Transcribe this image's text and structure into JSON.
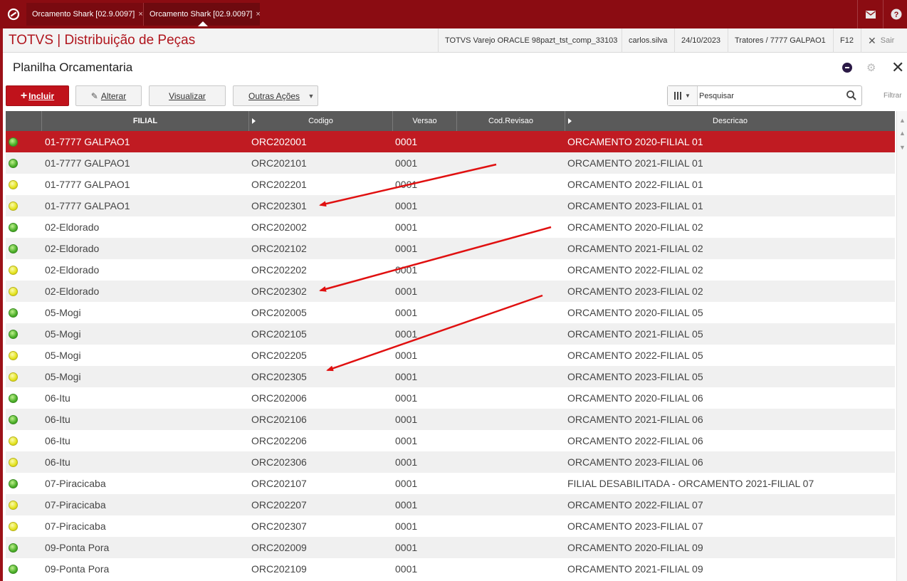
{
  "tabs": [
    {
      "label": "Orcamento Shark [02.9.0097]",
      "close": "×"
    },
    {
      "label": "Orcamento Shark [02.9.0097]",
      "close": "×"
    }
  ],
  "header": {
    "app_title": "TOTVS | Distribuição de Peças",
    "environment": "TOTVS Varejo ORACLE 98pazt_tst_comp_33103",
    "user": "carlos.silva",
    "date": "24/10/2023",
    "branch": "Tratores / 7777 GALPAO1",
    "shortcut": "F12",
    "exit_label": "Sair"
  },
  "page": {
    "title": "Planilha Orcamentaria"
  },
  "toolbar": {
    "include_label": "Incluir",
    "alter_label": "Alterar",
    "view_label": "Visualizar",
    "more_actions_label": "Outras Ações"
  },
  "search": {
    "placeholder": "Pesquisar",
    "filter_label": "Filtrar"
  },
  "colors": {
    "brand_red": "#8b0c12",
    "selected_row": "#c01b22",
    "status_green": "#4db02a",
    "status_yellow": "#e4e31f"
  },
  "grid": {
    "columns": [
      "FILIAL",
      "Codigo",
      "Versao",
      "Cod.Revisao",
      "Descricao"
    ],
    "rows": [
      {
        "status": "green",
        "filial": "01-7777 GALPAO1",
        "codigo": "ORC202001",
        "versao": "0001",
        "cod_revisao": "",
        "descricao": "ORCAMENTO 2020-FILIAL 01",
        "selected": true
      },
      {
        "status": "green",
        "filial": "01-7777 GALPAO1",
        "codigo": "ORC202101",
        "versao": "0001",
        "cod_revisao": "",
        "descricao": "ORCAMENTO 2021-FILIAL 01"
      },
      {
        "status": "yellow",
        "filial": "01-7777 GALPAO1",
        "codigo": "ORC202201",
        "versao": "0001",
        "cod_revisao": "",
        "descricao": "ORCAMENTO 2022-FILIAL 01"
      },
      {
        "status": "yellow",
        "filial": "01-7777 GALPAO1",
        "codigo": "ORC202301",
        "versao": "0001",
        "cod_revisao": "",
        "descricao": "ORCAMENTO 2023-FILIAL 01"
      },
      {
        "status": "green",
        "filial": "02-Eldorado",
        "codigo": "ORC202002",
        "versao": "0001",
        "cod_revisao": "",
        "descricao": "ORCAMENTO 2020-FILIAL 02"
      },
      {
        "status": "green",
        "filial": "02-Eldorado",
        "codigo": "ORC202102",
        "versao": "0001",
        "cod_revisao": "",
        "descricao": "ORCAMENTO 2021-FILIAL 02"
      },
      {
        "status": "yellow",
        "filial": "02-Eldorado",
        "codigo": "ORC202202",
        "versao": "0001",
        "cod_revisao": "",
        "descricao": "ORCAMENTO 2022-FILIAL 02"
      },
      {
        "status": "yellow",
        "filial": "02-Eldorado",
        "codigo": "ORC202302",
        "versao": "0001",
        "cod_revisao": "",
        "descricao": "ORCAMENTO 2023-FILIAL 02"
      },
      {
        "status": "green",
        "filial": "05-Mogi",
        "codigo": "ORC202005",
        "versao": "0001",
        "cod_revisao": "",
        "descricao": "ORCAMENTO 2020-FILIAL 05"
      },
      {
        "status": "green",
        "filial": "05-Mogi",
        "codigo": "ORC202105",
        "versao": "0001",
        "cod_revisao": "",
        "descricao": "ORCAMENTO 2021-FILIAL 05"
      },
      {
        "status": "yellow",
        "filial": "05-Mogi",
        "codigo": "ORC202205",
        "versao": "0001",
        "cod_revisao": "",
        "descricao": "ORCAMENTO 2022-FILIAL 05"
      },
      {
        "status": "yellow",
        "filial": "05-Mogi",
        "codigo": "ORC202305",
        "versao": "0001",
        "cod_revisao": "",
        "descricao": "ORCAMENTO 2023-FILIAL 05"
      },
      {
        "status": "green",
        "filial": "06-Itu",
        "codigo": "ORC202006",
        "versao": "0001",
        "cod_revisao": "",
        "descricao": "ORCAMENTO 2020-FILIAL 06"
      },
      {
        "status": "green",
        "filial": "06-Itu",
        "codigo": "ORC202106",
        "versao": "0001",
        "cod_revisao": "",
        "descricao": "ORCAMENTO 2021-FILIAL 06"
      },
      {
        "status": "yellow",
        "filial": "06-Itu",
        "codigo": "ORC202206",
        "versao": "0001",
        "cod_revisao": "",
        "descricao": "ORCAMENTO 2022-FILIAL 06"
      },
      {
        "status": "yellow",
        "filial": "06-Itu",
        "codigo": "ORC202306",
        "versao": "0001",
        "cod_revisao": "",
        "descricao": "ORCAMENTO 2023-FILIAL 06"
      },
      {
        "status": "green",
        "filial": "07-Piracicaba",
        "codigo": "ORC202107",
        "versao": "0001",
        "cod_revisao": "",
        "descricao": "FILIAL DESABILITADA - ORCAMENTO 2021-FILIAL 07"
      },
      {
        "status": "yellow",
        "filial": "07-Piracicaba",
        "codigo": "ORC202207",
        "versao": "0001",
        "cod_revisao": "",
        "descricao": "ORCAMENTO 2022-FILIAL 07"
      },
      {
        "status": "yellow",
        "filial": "07-Piracicaba",
        "codigo": "ORC202307",
        "versao": "0001",
        "cod_revisao": "",
        "descricao": "ORCAMENTO 2023-FILIAL 07"
      },
      {
        "status": "green",
        "filial": "09-Ponta Pora",
        "codigo": "ORC202009",
        "versao": "0001",
        "cod_revisao": "",
        "descricao": "ORCAMENTO 2020-FILIAL 09"
      },
      {
        "status": "green",
        "filial": "09-Ponta Pora",
        "codigo": "ORC202109",
        "versao": "0001",
        "cod_revisao": "",
        "descricao": "ORCAMENTO 2021-FILIAL 09"
      }
    ]
  }
}
